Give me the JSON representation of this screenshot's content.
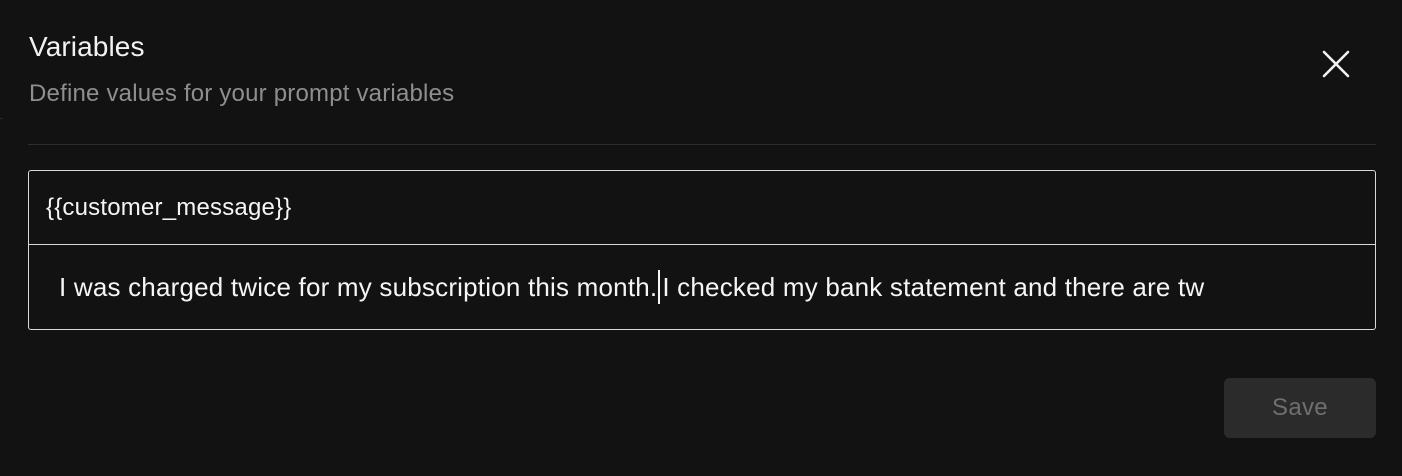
{
  "dialog": {
    "title": "Variables",
    "subtitle": "Define values for your prompt variables",
    "close_icon": "close-icon"
  },
  "variable": {
    "name": "{{customer_message}}",
    "value_before_caret": "I was charged twice for my subscription this month.",
    "value_after_caret": "I checked my bank statement and there are tw"
  },
  "actions": {
    "save_label": "Save",
    "save_disabled": true
  },
  "colors": {
    "background": "#121212",
    "text": "#f5f5f5",
    "muted_text": "#8e8e8e",
    "border": "#d9d9d9",
    "button_disabled_bg": "#2b2b2b",
    "button_disabled_text": "#6f6f6f"
  }
}
